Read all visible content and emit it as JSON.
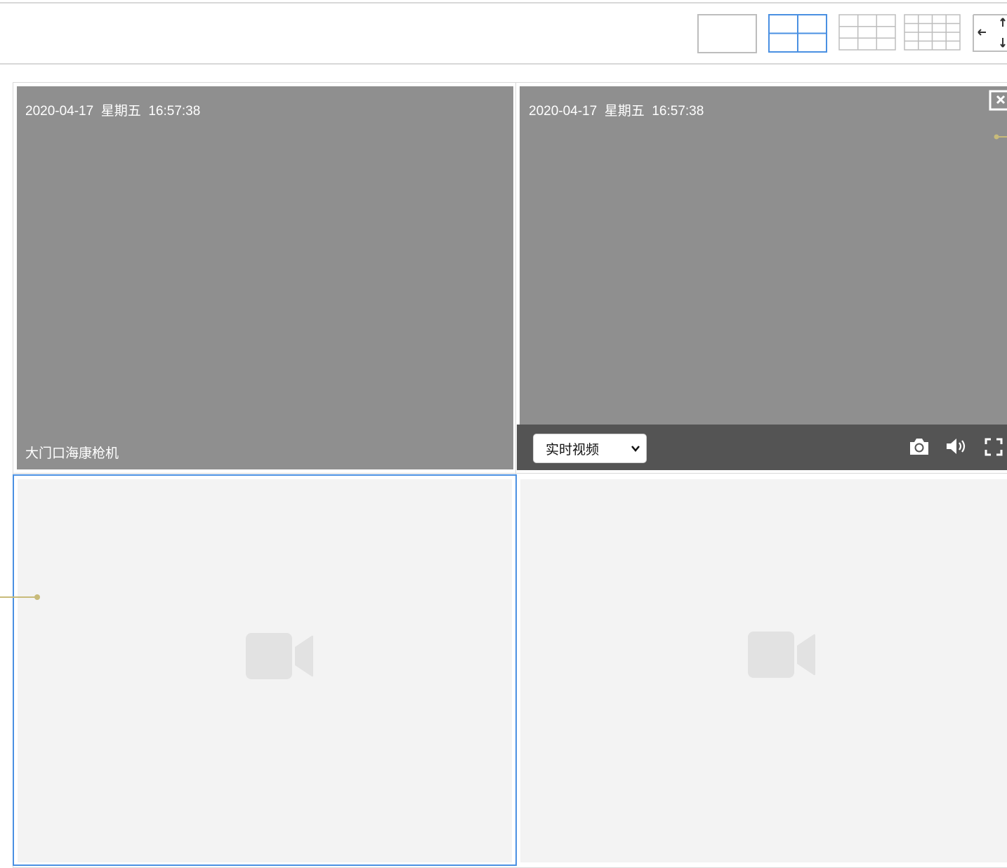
{
  "toolbar": {
    "layouts": [
      {
        "name": "1x1",
        "selected": false
      },
      {
        "name": "2x2",
        "selected": true
      },
      {
        "name": "3x3",
        "selected": false
      },
      {
        "name": "4x4",
        "selected": false
      }
    ],
    "extra_icon": "expand-arrows-icon"
  },
  "panes": [
    {
      "state": "playing",
      "date": "2020-04-17",
      "weekday": "星期五",
      "time": "16:57:38",
      "camera_name": "大门口海康枪机",
      "selected": false
    },
    {
      "state": "playing",
      "date": "2020-04-17",
      "weekday": "星期五",
      "time": "16:57:38",
      "selected": false,
      "controls": {
        "stream_select": {
          "value": "实时视频"
        },
        "icons": [
          "camera-snapshot-icon",
          "volume-icon",
          "fullscreen-icon"
        ],
        "close_icon": "close-icon"
      }
    },
    {
      "state": "empty",
      "icon": "video-camera-icon",
      "selected": true
    },
    {
      "state": "empty",
      "icon": "video-camera-icon",
      "selected": false
    }
  ],
  "colors": {
    "selected_border": "#4a90e2",
    "video_bg": "#8f8f8f",
    "control_bar": "#545454",
    "empty_bg": "#f3f3f3",
    "empty_icon": "#e2e2e2",
    "accent_line": "#c8bb7a"
  }
}
